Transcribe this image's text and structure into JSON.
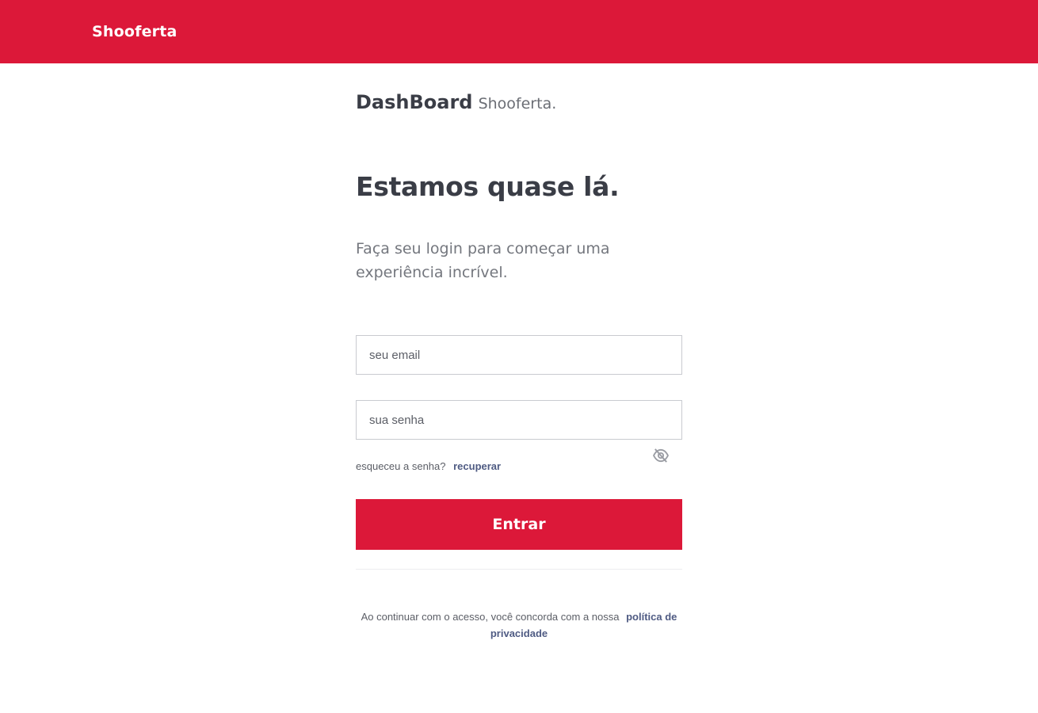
{
  "header": {
    "brand": "Shooferta",
    "background_color": "#dc1839"
  },
  "page": {
    "title_main": "DashBoard",
    "title_sub": "Shooferta.",
    "headline": "Estamos quase lá.",
    "subtext": "Faça seu login para começar uma experiência incrível."
  },
  "form": {
    "email_placeholder": "seu email",
    "email_value": "",
    "password_placeholder": "sua senha",
    "password_value": "",
    "password_toggle_icon": "eye-off-icon",
    "forgot_text": "esqueceu a senha?",
    "recover_link": "recuperar",
    "submit_label": "Entrar"
  },
  "footer": {
    "terms_text": "Ao continuar com o acesso, você concorda com a nossa",
    "privacy_link": "política de privacidade"
  },
  "colors": {
    "accent": "#dc1839",
    "link": "#4f5b83",
    "text": "#3a3d46"
  }
}
